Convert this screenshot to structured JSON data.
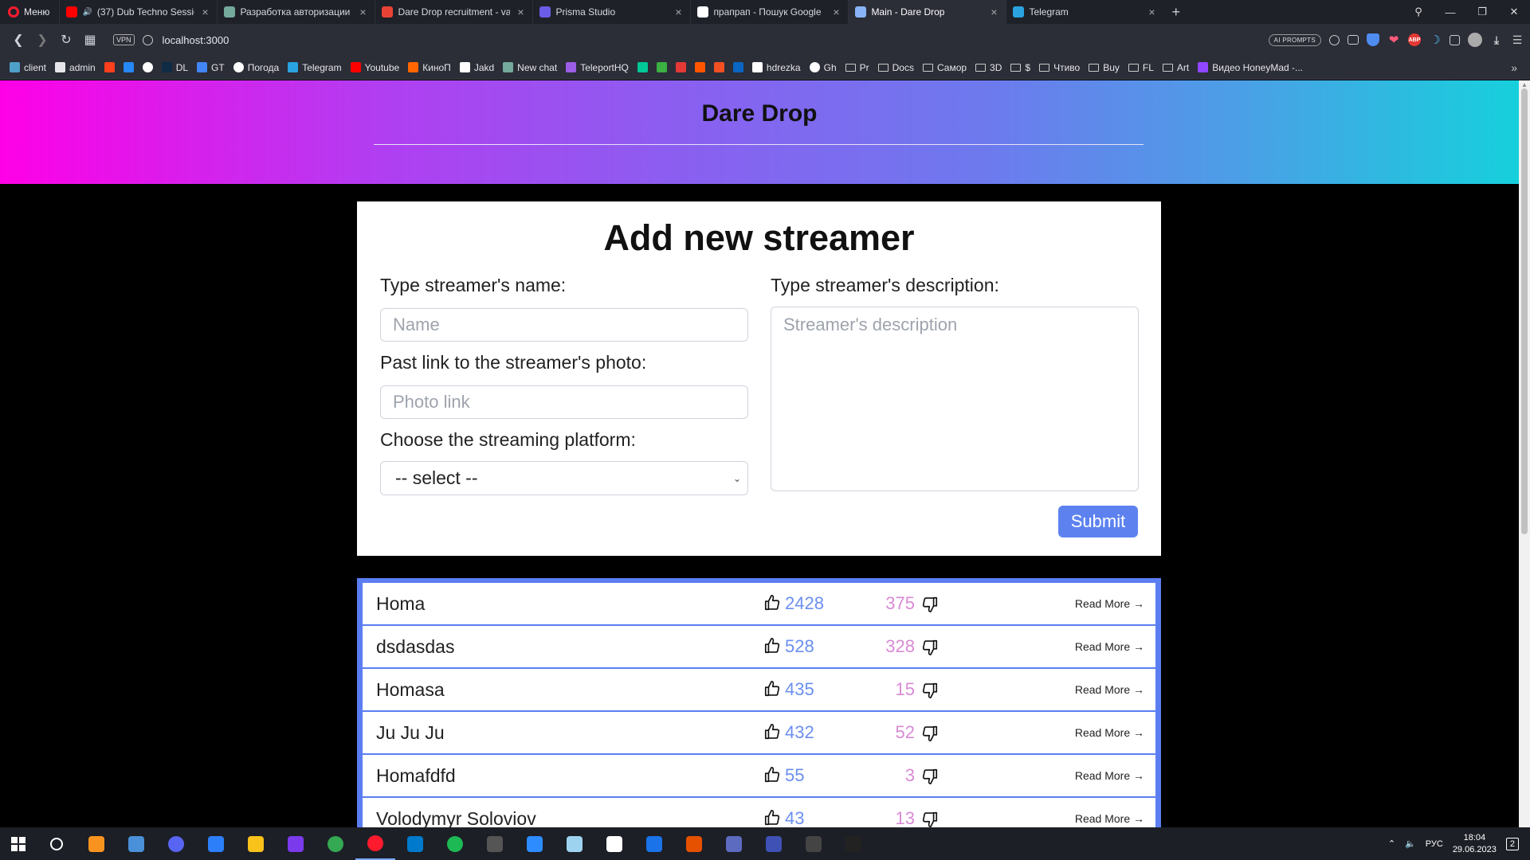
{
  "browser": {
    "menu_label": "Меню",
    "tabs": [
      {
        "title": "(37) Dub Techno Sessio",
        "favicon": "youtube-icon",
        "color": "#ff0000",
        "audio": true,
        "active": false
      },
      {
        "title": "Разработка авторизации",
        "favicon": "chatgpt-icon",
        "color": "#74aa9c",
        "active": false
      },
      {
        "title": "Dare Drop recruitment - va",
        "favicon": "gmail-icon",
        "color": "#ea4335",
        "active": false
      },
      {
        "title": "Prisma Studio",
        "favicon": "prisma-icon",
        "color": "#6b5ce7",
        "active": false
      },
      {
        "title": "прапрап - Пошук Google",
        "favicon": "google-icon",
        "color": "#ffffff",
        "active": false
      },
      {
        "title": "Main - Dare Drop",
        "favicon": "globe-icon",
        "color": "#8ab4f8",
        "active": true
      },
      {
        "title": "Telegram",
        "favicon": "telegram-icon",
        "color": "#2aa3e0",
        "active": false
      }
    ],
    "new_tab_label": "+",
    "url": "localhost:3000",
    "vpn_label": "VPN",
    "ai_prompts_label": "AI PROMPTS",
    "bookmarks": [
      {
        "label": "client",
        "icon": "client-icon",
        "color": "#4fa0c8"
      },
      {
        "label": "admin",
        "icon": "page-icon",
        "color": "#e6e6ea"
      },
      {
        "label": "",
        "icon": "yandex-icon",
        "color": "#fc3f1d"
      },
      {
        "label": "",
        "icon": "vk-icon",
        "color": "#2787f5"
      },
      {
        "label": "",
        "icon": "google-icon",
        "color": "#ffffff"
      },
      {
        "label": "DL",
        "icon": "deepl-icon",
        "color": "#0f2b46"
      },
      {
        "label": "GT",
        "icon": "translate-icon",
        "color": "#4285f4"
      },
      {
        "label": "Погода",
        "icon": "google-icon",
        "color": "#ffffff"
      },
      {
        "label": "Telegram",
        "icon": "telegram-icon",
        "color": "#2aa3e0"
      },
      {
        "label": "Youtube",
        "icon": "youtube-icon",
        "color": "#ff0000"
      },
      {
        "label": "КиноП",
        "icon": "kinopoisk-icon",
        "color": "#ff6600"
      },
      {
        "label": "Jakd",
        "icon": "check-icon",
        "color": "#ffffff"
      },
      {
        "label": "New chat",
        "icon": "chatgpt-icon",
        "color": "#74aa9c"
      },
      {
        "label": "TeleportHQ",
        "icon": "teleport-icon",
        "color": "#9b5de5"
      },
      {
        "label": "",
        "icon": "ext-green-icon",
        "color": "#00c896"
      },
      {
        "label": "",
        "icon": "ext-green2-icon",
        "color": "#3cb043"
      },
      {
        "label": "",
        "icon": "ext-red-icon",
        "color": "#e53935"
      },
      {
        "label": "",
        "icon": "soundcloud-icon",
        "color": "#ff5500"
      },
      {
        "label": "",
        "icon": "microsoft-icon",
        "color": "#f25022"
      },
      {
        "label": "",
        "icon": "linkedin-icon",
        "color": "#0a66c2"
      },
      {
        "label": "hdrezka",
        "icon": "hd-icon",
        "color": "#ffffff"
      },
      {
        "label": "Gh",
        "icon": "github-icon",
        "color": "#ffffff"
      },
      {
        "label": "Pr",
        "icon": "folder-icon",
        "color": ""
      },
      {
        "label": "Docs",
        "icon": "folder-icon",
        "color": ""
      },
      {
        "label": "Самор",
        "icon": "folder-icon",
        "color": ""
      },
      {
        "label": "3D",
        "icon": "folder-icon",
        "color": ""
      },
      {
        "label": "$",
        "icon": "folder-icon",
        "color": ""
      },
      {
        "label": "Чтиво",
        "icon": "folder-icon",
        "color": ""
      },
      {
        "label": "Buy",
        "icon": "folder-icon",
        "color": ""
      },
      {
        "label": "FL",
        "icon": "folder-icon",
        "color": ""
      },
      {
        "label": "Art",
        "icon": "folder-icon",
        "color": ""
      },
      {
        "label": "Видео HoneyMad -...",
        "icon": "twitch-icon",
        "color": "#9146ff"
      }
    ]
  },
  "page": {
    "site_title": "Dare Drop",
    "form": {
      "heading": "Add new streamer",
      "name_label": "Type streamer's name:",
      "name_placeholder": "Name",
      "photo_label": "Past link to the streamer's photo:",
      "photo_placeholder": "Photo link",
      "platform_label": "Choose the streaming platform:",
      "platform_selected": "-- select --",
      "description_label": "Type streamer's description:",
      "description_placeholder": "Streamer's description",
      "submit_label": "Submit"
    },
    "streamers": [
      {
        "name": "Homa",
        "upvotes": "2428",
        "downvotes": "375",
        "read_more": "Read More →"
      },
      {
        "name": "dsdasdas",
        "upvotes": "528",
        "downvotes": "328",
        "read_more": "Read More →"
      },
      {
        "name": "Homasa",
        "upvotes": "435",
        "downvotes": "15",
        "read_more": "Read More →"
      },
      {
        "name": "Ju Ju Ju",
        "upvotes": "432",
        "downvotes": "52",
        "read_more": "Read More →"
      },
      {
        "name": "Homafdfd",
        "upvotes": "55",
        "downvotes": "3",
        "read_more": "Read More →"
      },
      {
        "name": "Volodymyr Soloviov",
        "upvotes": "43",
        "downvotes": "13",
        "read_more": "Read More →"
      }
    ],
    "colors": {
      "upvote": "#6b8ff0",
      "downvote": "#d98ad5",
      "accent": "#5d82f0"
    }
  },
  "taskbar": {
    "apps": [
      {
        "icon": "search-icon",
        "color": "#ffffff"
      },
      {
        "icon": "fl-studio-icon",
        "color": "#f7931e"
      },
      {
        "icon": "calculator-icon",
        "color": "#4a90d9"
      },
      {
        "icon": "discord-icon",
        "color": "#5865f2"
      },
      {
        "icon": "app-blue-icon",
        "color": "#2d7ff9"
      },
      {
        "icon": "file-explorer-icon",
        "color": "#f8c21a"
      },
      {
        "icon": "obsidian-icon",
        "color": "#7c3aed"
      },
      {
        "icon": "chrome-icon",
        "color": "#34a853"
      },
      {
        "icon": "opera-icon",
        "color": "#ff1b2d"
      },
      {
        "icon": "vscode-icon",
        "color": "#007acc"
      },
      {
        "icon": "spotify-icon",
        "color": "#1db954"
      },
      {
        "icon": "terminal-icon",
        "color": "#555555"
      },
      {
        "icon": "app-c-icon",
        "color": "#2d8cff"
      },
      {
        "icon": "notepad-icon",
        "color": "#9ed3f0"
      },
      {
        "icon": "file-icon",
        "color": "#ffffff"
      },
      {
        "icon": "maps-icon",
        "color": "#1a73e8"
      },
      {
        "icon": "app-orange-icon",
        "color": "#e65100"
      },
      {
        "icon": "vs-icon",
        "color": "#5c6bc0"
      },
      {
        "icon": "vs2-icon",
        "color": "#3f51b5"
      },
      {
        "icon": "photo-icon",
        "color": "#444444"
      },
      {
        "icon": "cmd-icon",
        "color": "#222222"
      }
    ],
    "language": "РУС",
    "time": "18:04",
    "date": "29.06.2023",
    "notifications": "2"
  }
}
